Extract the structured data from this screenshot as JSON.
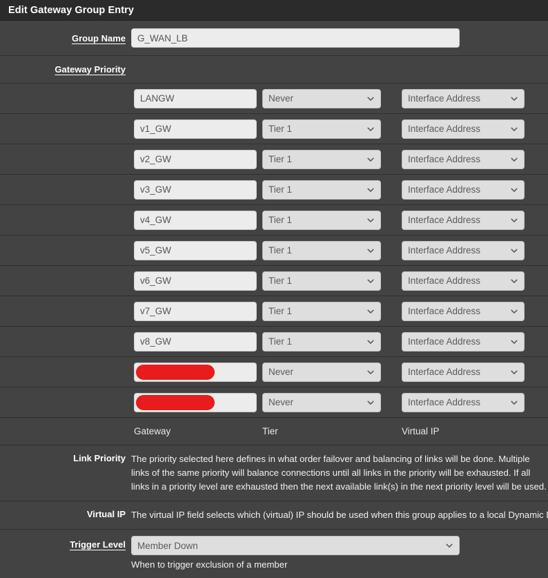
{
  "window": {
    "title": "Edit Gateway Group Entry"
  },
  "colors": {
    "panel_bg": "#434343",
    "titlebar_bg": "#2b2b2b",
    "input_bg": "#ececec",
    "select_bg": "#dedede",
    "redaction": "#e81c1c",
    "text": "#e8e8e8"
  },
  "group_name": {
    "label": "Group Name",
    "value": "G_WAN_LB",
    "placeholder": ""
  },
  "gateway_priority": {
    "label": "Gateway Priority"
  },
  "columns": {
    "gateway": "Gateway",
    "tier": "Tier",
    "virtual_ip": "Virtual IP"
  },
  "gateways": [
    {
      "name": "LANGW",
      "tier": "Never",
      "virtual_ip": "Interface Address",
      "redacted": false
    },
    {
      "name": "v1_GW",
      "tier": "Tier 1",
      "virtual_ip": "Interface Address",
      "redacted": false
    },
    {
      "name": "v2_GW",
      "tier": "Tier 1",
      "virtual_ip": "Interface Address",
      "redacted": false
    },
    {
      "name": "v3_GW",
      "tier": "Tier 1",
      "virtual_ip": "Interface Address",
      "redacted": false
    },
    {
      "name": "v4_GW",
      "tier": "Tier 1",
      "virtual_ip": "Interface Address",
      "redacted": false
    },
    {
      "name": "v5_GW",
      "tier": "Tier 1",
      "virtual_ip": "Interface Address",
      "redacted": false
    },
    {
      "name": "v6_GW",
      "tier": "Tier 1",
      "virtual_ip": "Interface Address",
      "redacted": false
    },
    {
      "name": "v7_GW",
      "tier": "Tier 1",
      "virtual_ip": "Interface Address",
      "redacted": false
    },
    {
      "name": "v8_GW",
      "tier": "Tier 1",
      "virtual_ip": "Interface Address",
      "redacted": false
    },
    {
      "name": "",
      "tier": "Never",
      "virtual_ip": "Interface Address",
      "redacted": true
    },
    {
      "name": "",
      "tier": "Never",
      "virtual_ip": "Interface Address",
      "redacted": true
    }
  ],
  "link_priority": {
    "label": "Link Priority",
    "text": "The priority selected here defines in what order failover and balancing of links will be done. Multiple links of the same priority will balance connections until all links in the priority will be exhausted. If all links in a priority level are exhausted then the next available link(s) in the next priority level will be used."
  },
  "virtual_ip_help": {
    "label": "Virtual IP",
    "text": "The virtual IP field selects which (virtual) IP should be used when this group applies to a local Dynamic DNS, IPsec or OpenVPN endpoint."
  },
  "trigger_level": {
    "label": "Trigger Level",
    "value": "Member Down",
    "note": "When to trigger exclusion of a member"
  }
}
